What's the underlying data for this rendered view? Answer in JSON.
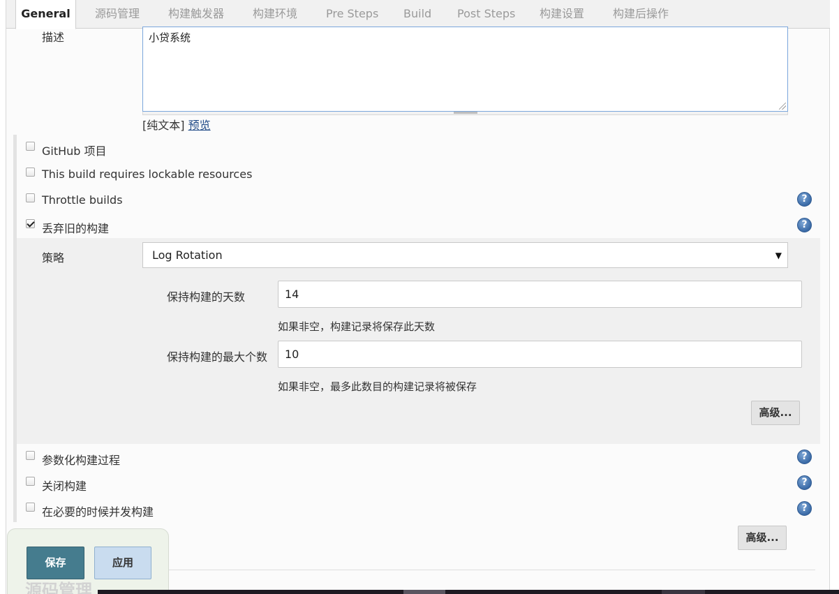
{
  "tabs": [
    {
      "label": "General",
      "active": true
    },
    {
      "label": "源码管理"
    },
    {
      "label": "构建触发器"
    },
    {
      "label": "构建环境"
    },
    {
      "label": "Pre Steps"
    },
    {
      "label": "Build"
    },
    {
      "label": "Post Steps"
    },
    {
      "label": "构建设置"
    },
    {
      "label": "构建后操作"
    }
  ],
  "description": {
    "label": "描述",
    "value": "小贷系统",
    "format_prefix": "[纯文本]",
    "preview_link": "预览"
  },
  "options": [
    {
      "label": "GitHub 项目",
      "checked": false,
      "help": false
    },
    {
      "label": "This build requires lockable resources",
      "checked": false,
      "help": false
    },
    {
      "label": "Throttle builds",
      "checked": false,
      "help": true
    },
    {
      "label": "丢弃旧的构建",
      "checked": true,
      "help": true
    }
  ],
  "discard": {
    "strategy_label": "策略",
    "strategy_value": "Log Rotation",
    "days_label": "保持构建的天数",
    "days_value": "14",
    "days_hint": "如果非空，构建记录将保存此天数",
    "max_label": "保持构建的最大个数",
    "max_value": "10",
    "max_hint": "如果非空，最多此数目的构建记录将被保存",
    "advanced_label": "高级..."
  },
  "options_after": [
    {
      "label": "参数化构建过程",
      "checked": false,
      "help": true
    },
    {
      "label": "关闭构建",
      "checked": false,
      "help": true
    },
    {
      "label": "在必要的时候并发构建",
      "checked": false,
      "help": true
    }
  ],
  "general_advanced_label": "高级...",
  "help_glyph": "?",
  "dropdown_arrow": "▼",
  "buttons": {
    "save": "保存",
    "apply": "应用"
  },
  "next_section_heading": "源码管理",
  "icons": {
    "help": "help-icon",
    "check": "checkbox"
  },
  "colors": {
    "save_bg": "#457c8e",
    "apply_bg": "#c9dcef",
    "help_bg": "#3a6aa6",
    "link": "#204a87"
  }
}
